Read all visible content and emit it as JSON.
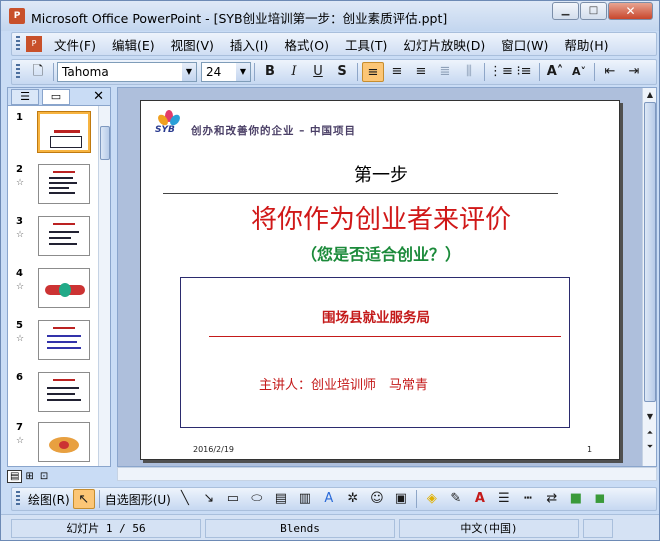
{
  "window": {
    "title": "Microsoft Office PowerPoint - [SYB创业培训第一步：创业素质评估.ppt]",
    "app_icon": "P"
  },
  "menu": [
    "文件(F)",
    "编辑(E)",
    "视图(V)",
    "插入(I)",
    "格式(O)",
    "工具(T)",
    "幻灯片放映(D)",
    "窗口(W)",
    "帮助(H)"
  ],
  "format": {
    "font": "Tahoma",
    "size": "24"
  },
  "thumbnails": [
    "1",
    "2",
    "3",
    "4",
    "5",
    "6",
    "7"
  ],
  "slide": {
    "logo_text": "SYB",
    "tagline": "创办和改善你的企业 – 中国项目",
    "step": "第一步",
    "title": "将你作为创业者来评价",
    "subtitle": "（您是否适合创业？）",
    "org": "围场县就业服务局",
    "speaker": "主讲人：创业培训师　马常青",
    "date": "2016/2/19",
    "page": "1"
  },
  "draw": {
    "label": "绘图(R)",
    "autoshapes": "自选图形(U)"
  },
  "status": {
    "slide": "幻灯片 1 / 56",
    "template": "Blends",
    "language": "中文(中国)"
  },
  "colors": {
    "title_red": "#d01818",
    "subtitle_green": "#1b8a3a"
  }
}
